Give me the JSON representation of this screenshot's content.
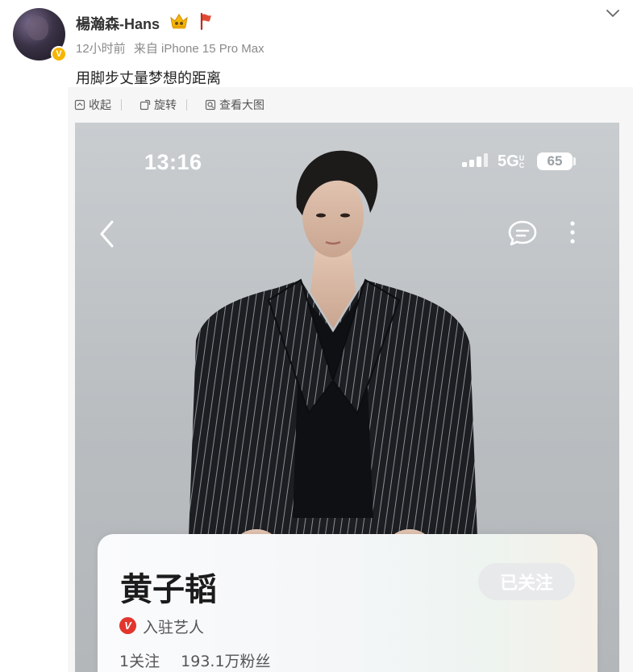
{
  "post": {
    "author": {
      "name": "楊瀚森-Hans",
      "verified_badge": "V",
      "icons": [
        "crown-icon",
        "flag-icon"
      ]
    },
    "time": "12小时前",
    "source": "来自 iPhone 15 Pro Max",
    "text": "用脚步丈量梦想的距离",
    "toolbar": {
      "collapse": "收起",
      "rotate": "旋转",
      "view_large": "查看大图"
    }
  },
  "screenshot": {
    "status_bar": {
      "time": "13:16",
      "network": "5G",
      "network_suffix": "UC",
      "battery": "65"
    },
    "profile": {
      "name": "黄子韬",
      "follow_button": "已关注",
      "verified_badge": "V",
      "verification_type": "入驻艺人",
      "following": "1关注",
      "followers": "193.1万粉丝"
    }
  },
  "colors": {
    "brand_orange": "#f7b500",
    "verified_red": "#e2352d",
    "panel_bg": "#f6f6f7"
  }
}
